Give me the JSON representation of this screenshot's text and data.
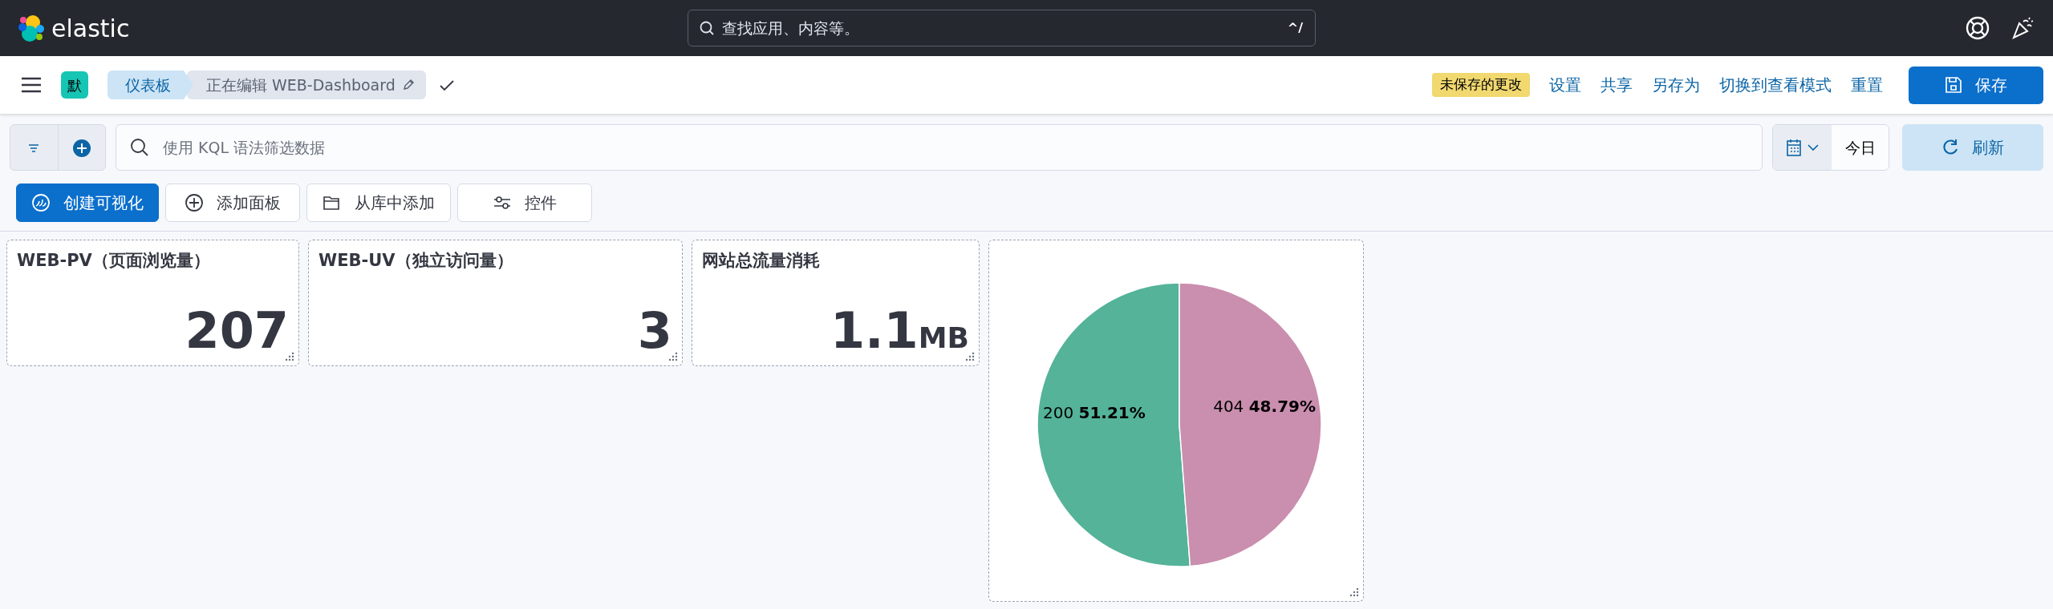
{
  "header": {
    "logo": "elastic",
    "search": {
      "placeholder": "查找应用、内容等。",
      "shortcut": "^/"
    }
  },
  "toolbar": {
    "space_avatar": "默",
    "breadcrumbs": [
      {
        "label": "仪表板",
        "selected": false
      },
      {
        "label": "正在编辑 WEB-Dashboard",
        "selected": true
      }
    ],
    "unsaved_badge": "未保存的更改",
    "links": [
      "设置",
      "共享",
      "另存为",
      "切换到查看模式",
      "重置"
    ],
    "save_button": "保存"
  },
  "query_bar": {
    "placeholder": "使用 KQL 语法筛选数据",
    "date": "今日",
    "refresh_button": "刷新"
  },
  "actions": [
    {
      "label": "创建可视化",
      "kind": "create"
    },
    {
      "label": "添加面板",
      "kind": "add"
    },
    {
      "label": "从库中添加",
      "kind": "library"
    },
    {
      "label": "控件",
      "kind": "controls"
    }
  ],
  "panels": [
    {
      "kind": "metric",
      "title": "WEB-PV（页面浏览量）",
      "value": "207"
    },
    {
      "kind": "metric",
      "title": "WEB-UV（独立访问量）",
      "value": "3"
    },
    {
      "kind": "metric",
      "title": "网站总流量消耗",
      "value": "1.1",
      "unit": "MB"
    },
    {
      "kind": "pie",
      "chart_data": {
        "type": "pie",
        "categories": [
          "200",
          "404"
        ],
        "values": [
          51.21,
          48.79
        ],
        "colors": [
          "#54b399",
          "#ca8eae"
        ],
        "value_labels": [
          "51.21%",
          "48.79%"
        ]
      }
    }
  ]
}
